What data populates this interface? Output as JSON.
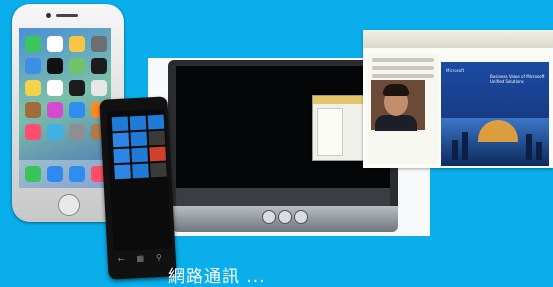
{
  "image": {
    "description_icons": {
      "iphone_apps": [
        "messages-icon",
        "calendar-icon",
        "photos-icon",
        "camera-icon",
        "weather-icon",
        "clock-icon",
        "maps-icon",
        "videos-icon",
        "notes-icon",
        "reminders-icon",
        "stocks-icon",
        "game-center-icon",
        "newsstand-icon",
        "itunes-icon",
        "app-store-icon",
        "books-icon",
        "health-icon",
        "passbook-icon",
        "settings-icon",
        "contacts-icon"
      ],
      "iphone_dock": [
        "phone-icon",
        "mail-icon",
        "safari-icon",
        "music-icon"
      ],
      "windows_tiles": [
        "phone-tile",
        "people-tile",
        "messaging-tile",
        "mail-tile",
        "calendar-tile",
        "photos-tile",
        "store-tile",
        "maps-tile",
        "music-tile",
        "camera-tile",
        "edge-tile",
        "settings-tile"
      ]
    },
    "colors": {
      "background": "#0aaeea",
      "caption": "#ffffff"
    }
  },
  "slide": {
    "brand": "Microsoft",
    "title": "Business Value of Microsoft Unified Solutions"
  },
  "caption": {
    "text": "網路通訊 ..."
  }
}
